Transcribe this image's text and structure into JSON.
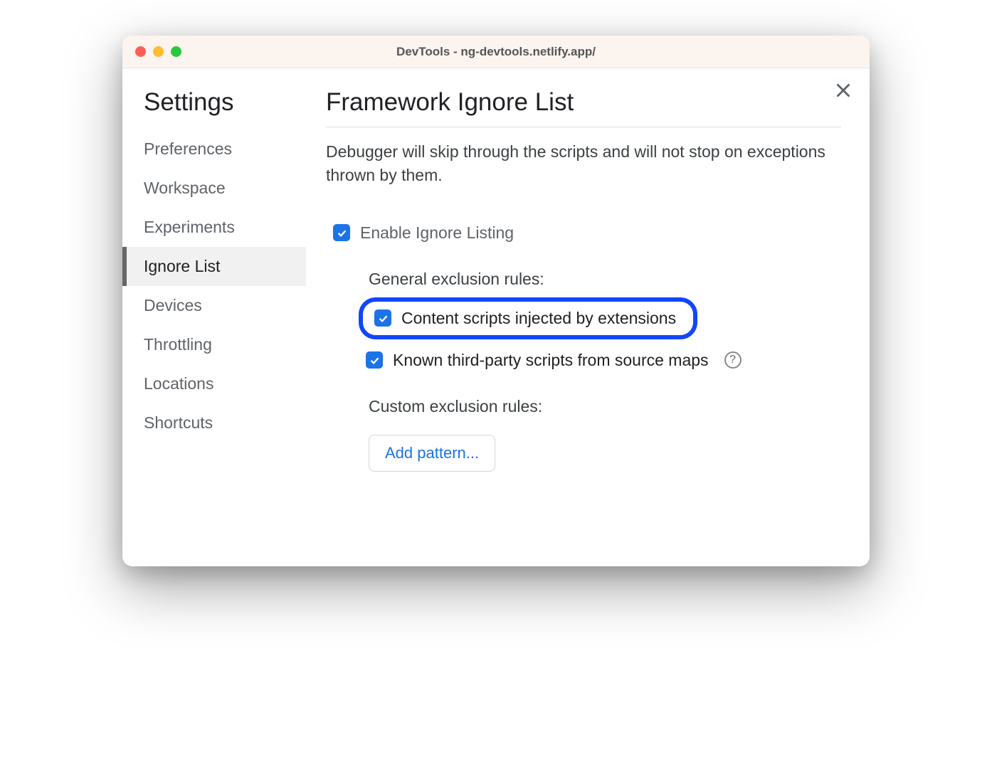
{
  "window": {
    "title": "DevTools - ng-devtools.netlify.app/"
  },
  "sidebar": {
    "title": "Settings",
    "items": [
      {
        "label": "Preferences",
        "active": false
      },
      {
        "label": "Workspace",
        "active": false
      },
      {
        "label": "Experiments",
        "active": false
      },
      {
        "label": "Ignore List",
        "active": true
      },
      {
        "label": "Devices",
        "active": false
      },
      {
        "label": "Throttling",
        "active": false
      },
      {
        "label": "Locations",
        "active": false
      },
      {
        "label": "Shortcuts",
        "active": false
      }
    ]
  },
  "main": {
    "title": "Framework Ignore List",
    "description": "Debugger will skip through the scripts and will not stop on exceptions thrown by them.",
    "enable_label": "Enable Ignore Listing",
    "enable_checked": true,
    "general_heading": "General exclusion rules:",
    "rules": [
      {
        "label": "Content scripts injected by extensions",
        "checked": true,
        "highlighted": true,
        "help": false
      },
      {
        "label": "Known third-party scripts from source maps",
        "checked": true,
        "highlighted": false,
        "help": true
      }
    ],
    "custom_heading": "Custom exclusion rules:",
    "add_button": "Add pattern..."
  }
}
